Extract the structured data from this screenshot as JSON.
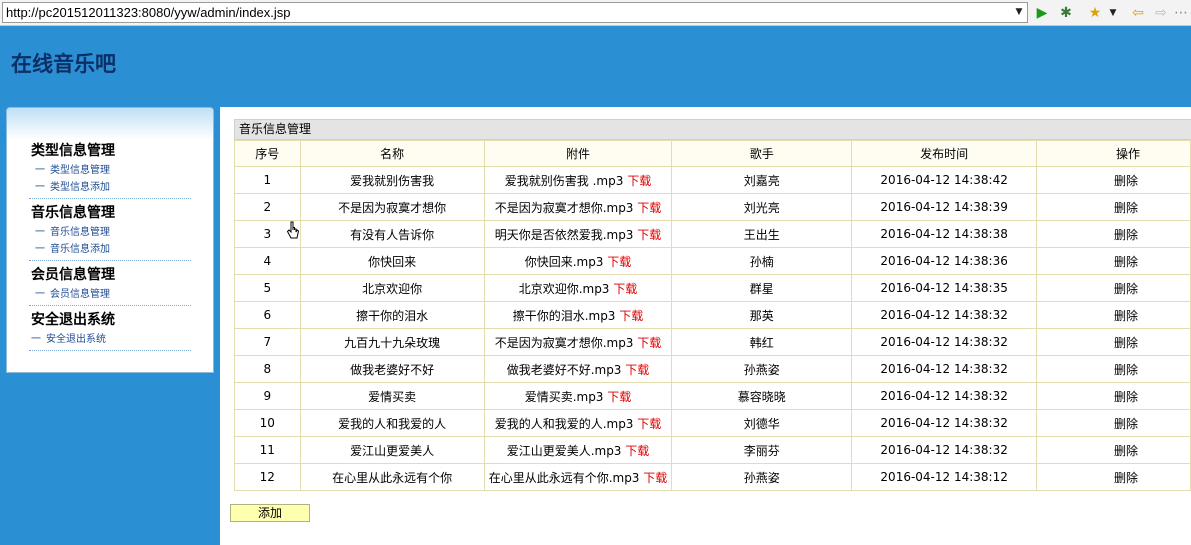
{
  "browser": {
    "url": "http://pc201512011323:8080/yyw/admin/index.jsp"
  },
  "header": {
    "title": "在线音乐吧"
  },
  "sidebar": {
    "groups": [
      {
        "title": "类型信息管理",
        "items": [
          "类型信息管理",
          "类型信息添加"
        ]
      },
      {
        "title": "音乐信息管理",
        "items": [
          "音乐信息管理",
          "音乐信息添加"
        ]
      },
      {
        "title": "会员信息管理",
        "items": [
          "会员信息管理"
        ]
      },
      {
        "title": "安全退出系统",
        "items": [
          "安全退出系统"
        ]
      }
    ],
    "bullet": "一"
  },
  "main": {
    "panel_title": "音乐信息管理",
    "columns": [
      "序号",
      "名称",
      "附件",
      "歌手",
      "发布时间",
      "操作"
    ],
    "download_label": "下载",
    "delete_label": "删除",
    "add_label": "添加",
    "rows": [
      {
        "no": "1",
        "name": "爱我就别伤害我",
        "file": "爱我就别伤害我 .mp3",
        "singer": "刘嘉亮",
        "time": "2016-04-12 14:38:42"
      },
      {
        "no": "2",
        "name": "不是因为寂寞才想你",
        "file": "不是因为寂寞才想你.mp3",
        "singer": "刘光亮",
        "time": "2016-04-12 14:38:39"
      },
      {
        "no": "3",
        "name": "有没有人告诉你",
        "file": "明天你是否依然爱我.mp3",
        "singer": "王出生",
        "time": "2016-04-12 14:38:38"
      },
      {
        "no": "4",
        "name": "你快回来",
        "file": "你快回来.mp3",
        "singer": "孙楠",
        "time": "2016-04-12 14:38:36"
      },
      {
        "no": "5",
        "name": "北京欢迎你",
        "file": "北京欢迎你.mp3",
        "singer": "群星",
        "time": "2016-04-12 14:38:35"
      },
      {
        "no": "6",
        "name": "擦干你的泪水",
        "file": "擦干你的泪水.mp3",
        "singer": "那英",
        "time": "2016-04-12 14:38:32"
      },
      {
        "no": "7",
        "name": "九百九十九朵玫瑰",
        "file": "不是因为寂寞才想你.mp3",
        "singer": "韩红",
        "time": "2016-04-12 14:38:32"
      },
      {
        "no": "8",
        "name": "做我老婆好不好",
        "file": "做我老婆好不好.mp3",
        "singer": "孙燕姿",
        "time": "2016-04-12 14:38:32"
      },
      {
        "no": "9",
        "name": "爱情买卖",
        "file": "爱情买卖.mp3",
        "singer": "慕容晓晓",
        "time": "2016-04-12 14:38:32"
      },
      {
        "no": "10",
        "name": "爱我的人和我爱的人",
        "file": "爱我的人和我爱的人.mp3",
        "singer": "刘德华",
        "time": "2016-04-12 14:38:32"
      },
      {
        "no": "11",
        "name": "爱江山更爱美人",
        "file": "爱江山更爱美人.mp3",
        "singer": "李丽芬",
        "time": "2016-04-12 14:38:32"
      },
      {
        "no": "12",
        "name": "在心里从此永远有个你",
        "file": "在心里从此永远有个你.mp3",
        "singer": "孙燕姿",
        "time": "2016-04-12 14:38:12"
      }
    ]
  },
  "colors": {
    "page_bg": "#2b8fd4",
    "title": "#0b2f66",
    "link": "#1f4d94",
    "download": "#e00000",
    "table_border": "#e3ddb0",
    "add_button_bg": "#ffffb0"
  },
  "icons": [
    "dropdown-arrow-icon",
    "go-icon",
    "debug-icon",
    "favorites-icon",
    "back-icon",
    "forward-icon",
    "mouse-cursor-icon"
  ]
}
